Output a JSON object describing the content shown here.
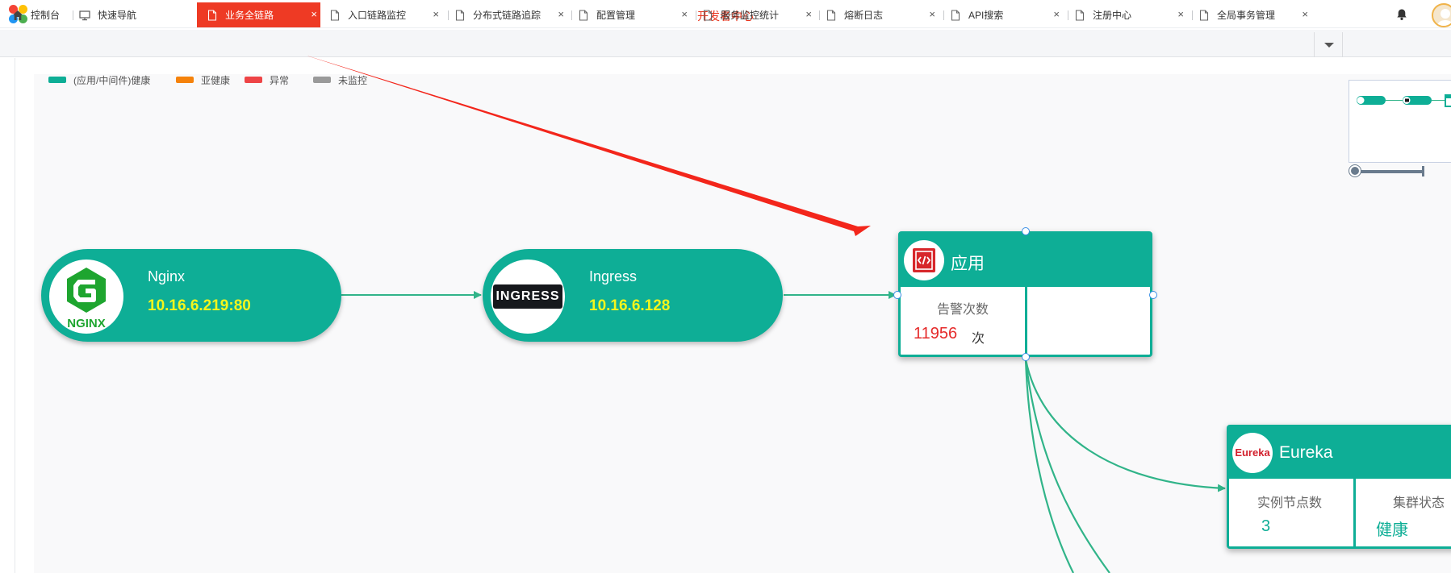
{
  "header": {
    "title": "开发者中心",
    "logo_colors": [
      "#f44336",
      "#ffc107",
      "#2196f3",
      "#4caf50"
    ]
  },
  "tabs": [
    {
      "label": "控制台",
      "icon": "home-icon"
    },
    {
      "label": "快速导航",
      "icon": "monitor-icon"
    },
    {
      "label": "业务全链路",
      "icon": "file-icon",
      "active": true
    },
    {
      "label": "入口链路监控",
      "icon": "file-icon"
    },
    {
      "label": "分布式链路追踪",
      "icon": "file-icon"
    },
    {
      "label": "配置管理",
      "icon": "file-icon"
    },
    {
      "label": "服务监控统计",
      "icon": "file-icon"
    },
    {
      "label": "熔断日志",
      "icon": "file-icon"
    },
    {
      "label": "API搜索",
      "icon": "file-icon"
    },
    {
      "label": "注册中心",
      "icon": "file-icon"
    },
    {
      "label": "全局事务管理",
      "icon": "file-icon"
    }
  ],
  "legend": [
    {
      "label": "(应用/中间件)健康",
      "color": "#0eae96"
    },
    {
      "label": "亚健康",
      "color": "#f5820b"
    },
    {
      "label": "异常",
      "color": "#ee4446"
    },
    {
      "label": "未监控",
      "color": "#9a9a9a"
    }
  ],
  "nodes": {
    "nginx": {
      "name": "Nginx",
      "address": "10.16.6.219:80",
      "logo_text": "NGINX"
    },
    "ingress": {
      "name": "Ingress",
      "address": "10.16.6.128",
      "logo_text": "INGRESS"
    },
    "app": {
      "title": "应用",
      "metric_label": "告警次数",
      "metric_value": "11956",
      "metric_unit": "次"
    },
    "eureka": {
      "title": "Eureka",
      "logo_text": "Eureka",
      "metric1_label": "实例节点数",
      "metric1_value": "3",
      "metric2_label": "集群状态",
      "metric2_value": "健康"
    }
  },
  "colors": {
    "accent": "#0eae96",
    "alert": "#e52b2b",
    "edge": "#31b489",
    "annotation_arrow": "#f3261b"
  }
}
